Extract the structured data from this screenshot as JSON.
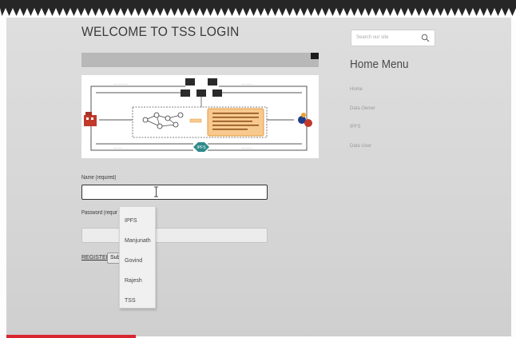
{
  "header": {
    "title": "WELCOME TO TSS LOGIN"
  },
  "diagram": {
    "center_label": "IPFS",
    "colors": {
      "orange": "#f7c98f",
      "orange_border": "#e69a3c",
      "teal": "#2f8a8a",
      "dark": "#2a2a2a",
      "red": "#c0392b"
    }
  },
  "form": {
    "name_label": "Name (required)",
    "name_value": "",
    "password_label": "Password (requir",
    "register_link": "REGISTER",
    "submit_label": "Sub"
  },
  "autocomplete": {
    "items": [
      "IPFS",
      "Manjunath",
      "Govind",
      "Rajesh",
      "TSS"
    ]
  },
  "sidebar": {
    "search_placeholder": "Search our site",
    "search_icon": "search-icon",
    "menu_title": "Home  Menu",
    "menu_items": [
      "Home",
      "Data Owner",
      "IPFS",
      "Data User"
    ]
  },
  "colors": {
    "accent_red": "#d8272f",
    "page_bg": "#d9d9d9"
  }
}
